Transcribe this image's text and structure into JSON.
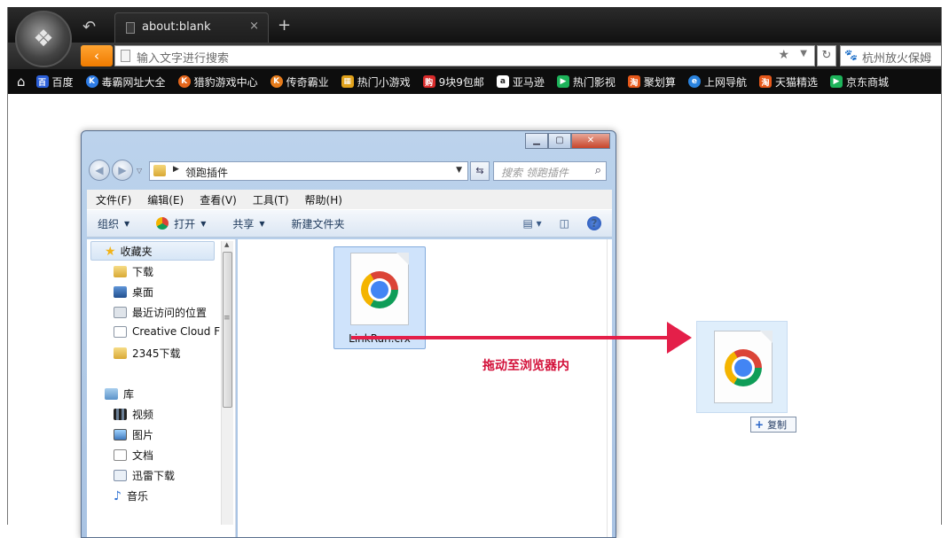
{
  "browser": {
    "tab_title": "about:blank",
    "new_tab": "+",
    "tab_close": "×",
    "address_placeholder": "输入文字进行搜索",
    "search_text": "杭州放火保姆",
    "bookmarks": [
      {
        "label": "百度",
        "icon": "baidu-icon",
        "color": "#2b5fd9"
      },
      {
        "label": "毒霸网址大全",
        "icon": "duba-icon",
        "color": "#2d7be5"
      },
      {
        "label": "猎豹游戏中心",
        "icon": "liebao-game-icon",
        "color": "#e5661b"
      },
      {
        "label": "传奇霸业",
        "icon": "chuanqi-icon",
        "color": "#e57b1b"
      },
      {
        "label": "热门小游戏",
        "icon": "game-icon",
        "color": "#e1a21b"
      },
      {
        "label": "9块9包邮",
        "icon": "gou-icon",
        "color": "#d92b2b"
      },
      {
        "label": "亚马逊",
        "icon": "amazon-icon",
        "color": "#222222"
      },
      {
        "label": "热门影视",
        "icon": "video-play-icon",
        "color": "#1db35a"
      },
      {
        "label": "聚划算",
        "icon": "juhuasuan-icon",
        "color": "#e6581a"
      },
      {
        "label": "上网导航",
        "icon": "ie-icon",
        "color": "#2a83de"
      },
      {
        "label": "天猫精选",
        "icon": "tmall-icon",
        "color": "#e6581a"
      },
      {
        "label": "京东商城",
        "icon": "jd-icon",
        "color": "#1db35a"
      }
    ]
  },
  "explorer": {
    "path": "领跑插件",
    "search_placeholder": "搜索 领跑插件",
    "menus": [
      "文件(F)",
      "编辑(E)",
      "查看(V)",
      "工具(T)",
      "帮助(H)"
    ],
    "commands": [
      "组织",
      "打开",
      "共享",
      "新建文件夹"
    ],
    "favorites_header": "收藏夹",
    "favorites": [
      "下载",
      "桌面",
      "最近访问的位置",
      "Creative Cloud F",
      "2345下载"
    ],
    "library_header": "库",
    "libraries": [
      "视频",
      "图片",
      "文档",
      "迅雷下载",
      "音乐"
    ],
    "file_name": "LinkRun.crx"
  },
  "annotation": {
    "arrow_label": "拖动至浏览器内",
    "copy_tooltip": "复制"
  },
  "colors": {
    "accent_red": "#e41f49",
    "browser_orange": "#f07b00"
  }
}
